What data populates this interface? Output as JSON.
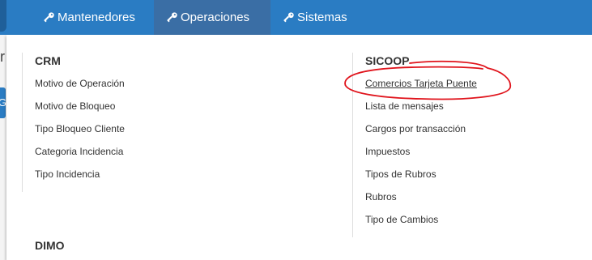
{
  "navbar": {
    "items": [
      {
        "label": "Mantenedores",
        "icon": "key-icon",
        "active": false
      },
      {
        "label": "Operaciones",
        "icon": "key-icon",
        "active": true
      },
      {
        "label": "Sistemas",
        "icon": "key-icon",
        "active": false
      }
    ]
  },
  "underpage": {
    "fragment": "r",
    "button_fragment": "G"
  },
  "menu": {
    "crm": {
      "title": "CRM",
      "items": [
        "Motivo de Operación",
        "Motivo de Bloqueo",
        "Tipo Bloqueo Cliente",
        "Categoria Incidencia",
        "Tipo Incidencia"
      ]
    },
    "dimo": {
      "title": "DIMO"
    },
    "sicoop": {
      "title": "SICOOP",
      "items": [
        "Comercios Tarjeta Puente",
        "Lista de mensajes",
        "Cargos por transacción",
        "Impuestos",
        "Tipos de Rubros",
        "Rubros",
        "Tipo de Cambios"
      ]
    }
  },
  "colors": {
    "navbar_bg": "#2a7cc3",
    "navbar_active": "#3a6ea5",
    "annotation_stroke": "#e0141c"
  }
}
